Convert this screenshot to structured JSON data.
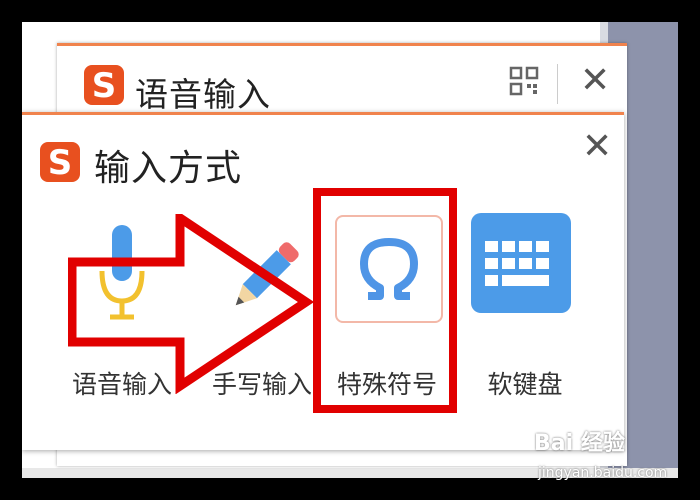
{
  "back_panel": {
    "title": "语音输入",
    "qr_icon": "qr-code-icon",
    "close_label": "✕"
  },
  "front_panel": {
    "title": "输入方式",
    "close_label": "✕",
    "items": [
      {
        "label": "语音输入",
        "icon": "microphone-icon"
      },
      {
        "label": "手写输入",
        "icon": "pencil-icon"
      },
      {
        "label": "特殊符号",
        "icon": "omega-icon"
      },
      {
        "label": "软键盘",
        "icon": "keyboard-icon"
      }
    ]
  },
  "colors": {
    "accent": "#f0834d",
    "logo": "#e8501f",
    "highlight": "#e10000",
    "keyboard": "#4c9be8",
    "omega": "#4f95e6"
  },
  "watermark": {
    "brand": "Bai 经验",
    "url": "jingyan.baidu.com"
  }
}
